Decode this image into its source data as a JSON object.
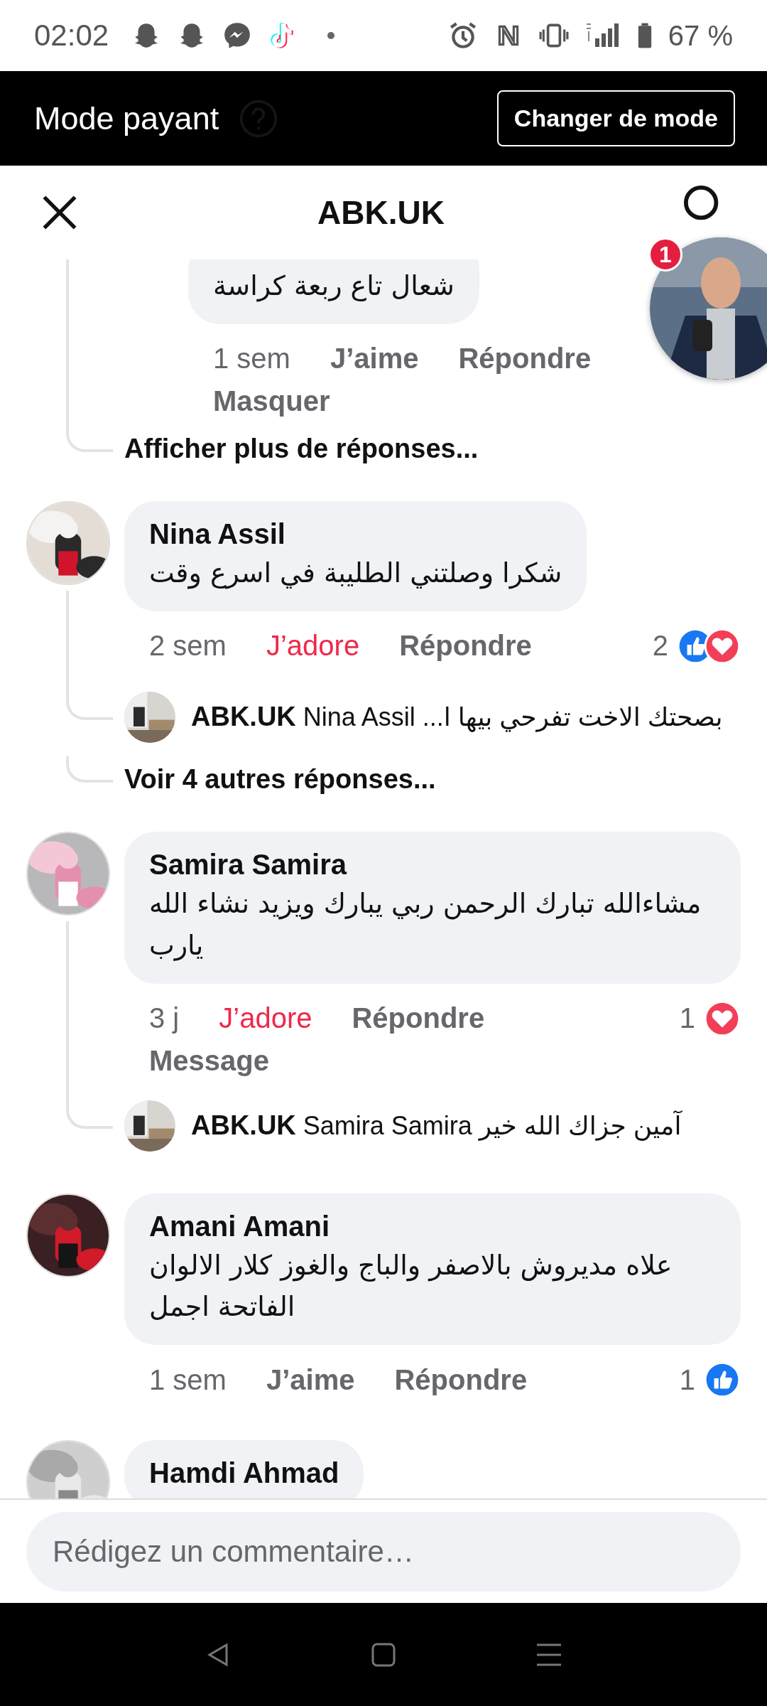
{
  "status_bar": {
    "time": "02:02",
    "battery": "67 %"
  },
  "banner": {
    "label": "Mode payant",
    "button": "Changer de mode"
  },
  "header": {
    "title": "ABK.UK"
  },
  "chat_head": {
    "badge": "1"
  },
  "top_thread": {
    "reply": {
      "text": "شعال تاع ربعة كراسة",
      "time": "1 sem",
      "reaction_label": "J’aime",
      "reacted": false,
      "reply_label": "Répondre",
      "extra_action": "Masquer"
    },
    "more_link": "Afficher plus de réponses..."
  },
  "comments": [
    {
      "name": "Nina Assil",
      "text": "شكرا وصلتني الطليبة في اسرع وقت",
      "time": "2 sem",
      "reaction_label": "J’adore",
      "reacted": true,
      "reply_label": "Répondre",
      "reaction_count": "2",
      "reaction_icons": [
        {
          "kind": "like"
        },
        {
          "kind": "love"
        }
      ],
      "replies": [
        {
          "author": "ABK.UK",
          "mention": "Nina Assil",
          "text": "بصحتك الاخت تفرحي بيها ا..."
        }
      ],
      "more_link": "Voir 4 autres réponses..."
    },
    {
      "name": "Samira Samira",
      "text": "مشاءالله تبارك الرحمن ربي يبارك ويزيد نشاء الله يارب",
      "time": "3 j",
      "reaction_label": "J’adore",
      "reacted": true,
      "reply_label": "Répondre",
      "extra_action": "Message",
      "reaction_count": "1",
      "reaction_icons": [
        {
          "kind": "love"
        }
      ],
      "replies": [
        {
          "author": "ABK.UK",
          "mention": "Samira Samira",
          "text": "آمين جزاك الله خير"
        }
      ]
    },
    {
      "name": "Amani Amani",
      "text": "علاه مديروش بالاصفر والباج والغوز كلار الالوان الفاتحة اجمل",
      "time": "1 sem",
      "reaction_label": "J’aime",
      "reacted": false,
      "reply_label": "Répondre",
      "reaction_count": "1",
      "reaction_icons": [
        {
          "kind": "like"
        }
      ]
    },
    {
      "name": "Hamdi Ahmad"
    }
  ],
  "composer": {
    "placeholder": "Rédigez un commentaire…"
  }
}
